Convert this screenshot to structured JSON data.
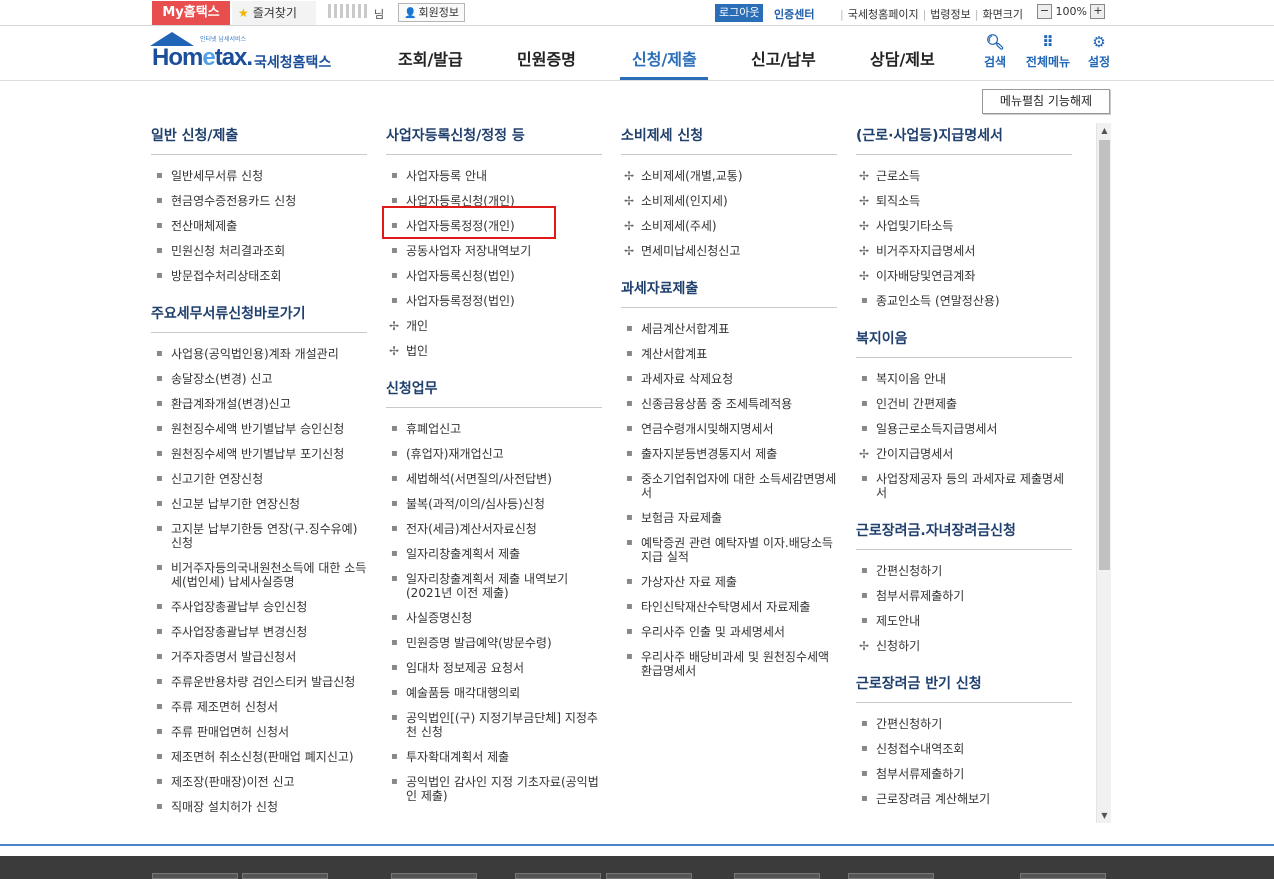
{
  "topbar": {
    "my_home": "My홈택스",
    "favorites": "즐겨찾기",
    "name_suffix": "님",
    "member_info": "회원정보",
    "logout": "로그아웃",
    "cert_center": "인증센터",
    "links": [
      "국세청홈페이지",
      "법령정보"
    ],
    "zoom_label": "화면크기",
    "zoom_minus": "−",
    "zoom_value": "100%",
    "zoom_plus": "+"
  },
  "header": {
    "logo_tiny": "인터넷 납세서비스",
    "logo_home_1": "Hom",
    "logo_home_e": "e",
    "logo_home_2": "tax.",
    "logo_korean": "국세청홈택스",
    "nav": [
      "조회/발급",
      "민원증명",
      "신청/제출",
      "신고/납부",
      "상담/제보"
    ],
    "active_nav": "신청/제출",
    "search": "검색",
    "all_menu": "전체메뉴",
    "settings": "설정"
  },
  "menu_toggle": "메뉴펼침 기능해제",
  "columns": [
    {
      "sections": [
        {
          "title": "일반 신청/제출",
          "items": [
            "일반세무서류 신청",
            "현금영수증전용카드 신청",
            "전산매체제출",
            "민원신청 처리결과조회",
            "방문접수처리상태조회"
          ]
        },
        {
          "title": "주요세무서류신청바로가기",
          "items": [
            "사업용(공익법인용)계좌 개설관리",
            "송달장소(변경) 신고",
            "환급계좌개설(변경)신고",
            "원천징수세액 반기별납부 승인신청",
            "원천징수세액 반기별납부 포기신청",
            "신고기한 연장신청",
            "신고분 납부기한 연장신청",
            "고지분 납부기한등 연장(구.징수유예)신청",
            "비거주자등의국내원천소득에 대한 소득세(법인세) 납세사실증명",
            "주사업장총괄납부 승인신청",
            "주사업장총괄납부 변경신청",
            "거주자증명서 발급신청서",
            "주류운반용차량 검인스티커 발급신청",
            "주류 제조면허 신청서",
            "주류 판매업면허 신청서",
            "제조면허 취소신청(판매업 폐지신고)",
            "제조장(판매장)이전 신고",
            "직매장 설치허가 신청"
          ]
        }
      ]
    },
    {
      "sections": [
        {
          "title": "사업자등록신청/정정 등",
          "items": [
            "사업자등록 안내",
            "사업자등록신청(개인)",
            "사업자등록정정(개인)",
            "공동사업자 저장내역보기",
            "사업자등록신청(법인)",
            "사업자등록정정(법인)",
            "개인",
            "법인"
          ]
        },
        {
          "title": "신청업무",
          "items": [
            "휴폐업신고",
            "(휴업자)재개업신고",
            "세법해석(서면질의/사전답변)",
            "불복(과적/이의/심사등)신청",
            "전자(세금)계산서자료신청",
            "일자리창출계획서 제출",
            "일자리창출계획서 제출 내역보기(2021년 이전 제출)",
            "사실증명신청",
            "민원증명 발급예약(방문수령)",
            "임대차 정보제공 요청서",
            "예술품등 매각대행의뢰",
            "공익법인[(구) 지정기부금단체] 지정추천 신청",
            "투자확대계획서 제출",
            "공익법인 감사인 지정 기초자료(공익법인 제출)"
          ]
        }
      ]
    },
    {
      "sections": [
        {
          "title": "소비제세 신청",
          "items": [
            "소비제세(개별,교통)",
            "소비제세(인지세)",
            "소비제세(주세)",
            "면세미납세신청신고"
          ]
        },
        {
          "title": "과세자료제출",
          "items": [
            "세금계산서합계표",
            "계산서합계표",
            "과세자료 삭제요청",
            "신종금융상품 중 조세특례적용",
            "연금수령개시및해지명세서",
            "출자지분등변경통지서 제출",
            "중소기업취업자에 대한 소득세감면명세서",
            "보험금 자료제출",
            "예탁증권 관련 예탁자별 이자.배당소득지급 실적",
            "가상자산 자료 제출",
            "타인신탁재산수탁명세서 자료제출",
            "우리사주 인출 및 과세명세서",
            "우리사주 배당비과세 및 원천징수세액환급명세서"
          ]
        }
      ]
    },
    {
      "sections": [
        {
          "title": "(근로·사업등)지급명세서",
          "items": [
            "근로소득",
            "퇴직소득",
            "사업및기타소득",
            "비거주자지급명세서",
            "이자배당및연금계좌",
            "종교인소득 (연말정산용)"
          ]
        },
        {
          "title": "복지이음",
          "items": [
            "복지이음 안내",
            "인건비 간편제출",
            "일용근로소득지급명세서",
            "간이지급명세서",
            "사업장제공자 등의 과세자료 제출명세서"
          ]
        },
        {
          "title": "근로장려금.자녀장려금신청",
          "items": [
            "간편신청하기",
            "첨부서류제출하기",
            "제도안내",
            "신청하기"
          ]
        },
        {
          "title": "근로장려금 반기 신청",
          "items": [
            "간편신청하기",
            "신청접수내역조회",
            "첨부서류제출하기",
            "근로장려금 계산해보기"
          ]
        }
      ]
    }
  ],
  "highlighted_item": "사업자등록정정(개인)"
}
